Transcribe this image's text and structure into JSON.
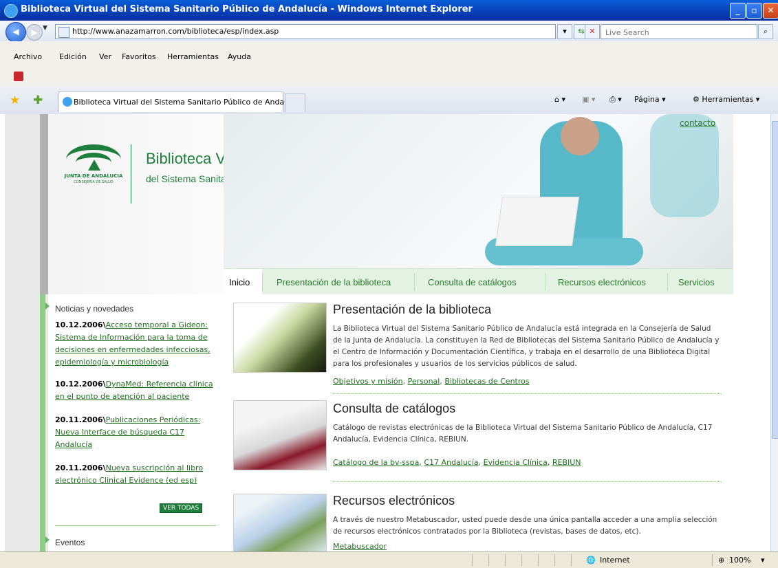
{
  "window": {
    "title": "Biblioteca Virtual del Sistema Sanitario Público de Andalucía - Windows Internet Explorer"
  },
  "addressbar": {
    "url": "http://www.anazamarron.com/biblioteca/esp/index.asp",
    "search_placeholder": "Live Search"
  },
  "menu": {
    "items": [
      "Archivo",
      "Edición",
      "Ver",
      "Favoritos",
      "Herramientas",
      "Ayuda"
    ]
  },
  "tabs": {
    "active_label": "Biblioteca Virtual del Sistema Sanitario Público de Anda..."
  },
  "commandbar": {
    "page": "Página",
    "tools": "Herramientas"
  },
  "page": {
    "contact": "contacto",
    "logo_line1": "JUNTA DE ANDALUCIA",
    "logo_line2": "CONSEJERÍA DE SALUD",
    "site_title": "Biblioteca Virtual",
    "site_subtitle": "del Sistema Sanitario Público de Andalucía",
    "nav": [
      "Inicio",
      "Presentación de la biblioteca",
      "Consulta de catálogos",
      "Recursos electrónicos",
      "Servicios"
    ],
    "news_title": "Noticias y novedades",
    "news": [
      {
        "date": "10.12.2006\\",
        "text": "Acceso temporal a Gideon: Sistema de Información para la toma de decisiones en enfermedades infecciosas, epidemiología y microbiología"
      },
      {
        "date": "10.12.2006\\",
        "text": "DynaMed: Referencia clínica en el punto de atención al paciente"
      },
      {
        "date": "20.11.2006\\",
        "text": "Publicaciones Periódicas: Nueva Interface de búsqueda C17 Andalucía"
      },
      {
        "date": "20.11.2006\\",
        "text": "Nueva suscripción al libro electrónico Clinical Evidence (ed esp)"
      }
    ],
    "ver_todas": "VER TODAS",
    "events_title": "Eventos",
    "sections": [
      {
        "title": "Presentación de la biblioteca",
        "desc": "La Biblioteca Virtual del Sistema Sanitario Público de Andalucía está integrada en la Consejería de Salud de la Junta de Andalucía. La constituyen la Red de Bibliotecas del Sistema Sanitario Público de Andalucía y el Centro de Información y Documentación Científica, y trabaja en el desarrollo de una Biblioteca Digital para los profesionales y usuarios de los servicios públicos de salud.",
        "links": [
          "Objetivos y misión",
          "Personal",
          "Bibliotecas de Centros"
        ]
      },
      {
        "title": "Consulta de catálogos",
        "desc": "Catálogo de revistas electrónicas de la Biblioteca Virtual del Sistema Sanitario Público de Andalucía, C17 Andalucía, Evidencia Clínica, REBIUN.",
        "links": [
          "Catálogo de la bv-sspa",
          "C17 Andalucía",
          "Evidencia Clínica",
          "REBIUN"
        ]
      },
      {
        "title": "Recursos electrónicos",
        "desc": "A través de nuestro Metabuscador, usted puede desde una única pantalla acceder a una amplia selección de recursos electrónicos contratados por la Biblioteca (revistas, bases de datos, etc).",
        "links": [
          "Metabuscador"
        ]
      }
    ]
  },
  "status": {
    "zone": "Internet",
    "zoom": "100%"
  },
  "colors": {
    "brand_green": "#1e7e3c",
    "link_green": "#1e6e1e",
    "xp_blue": "#0a3fb8"
  }
}
